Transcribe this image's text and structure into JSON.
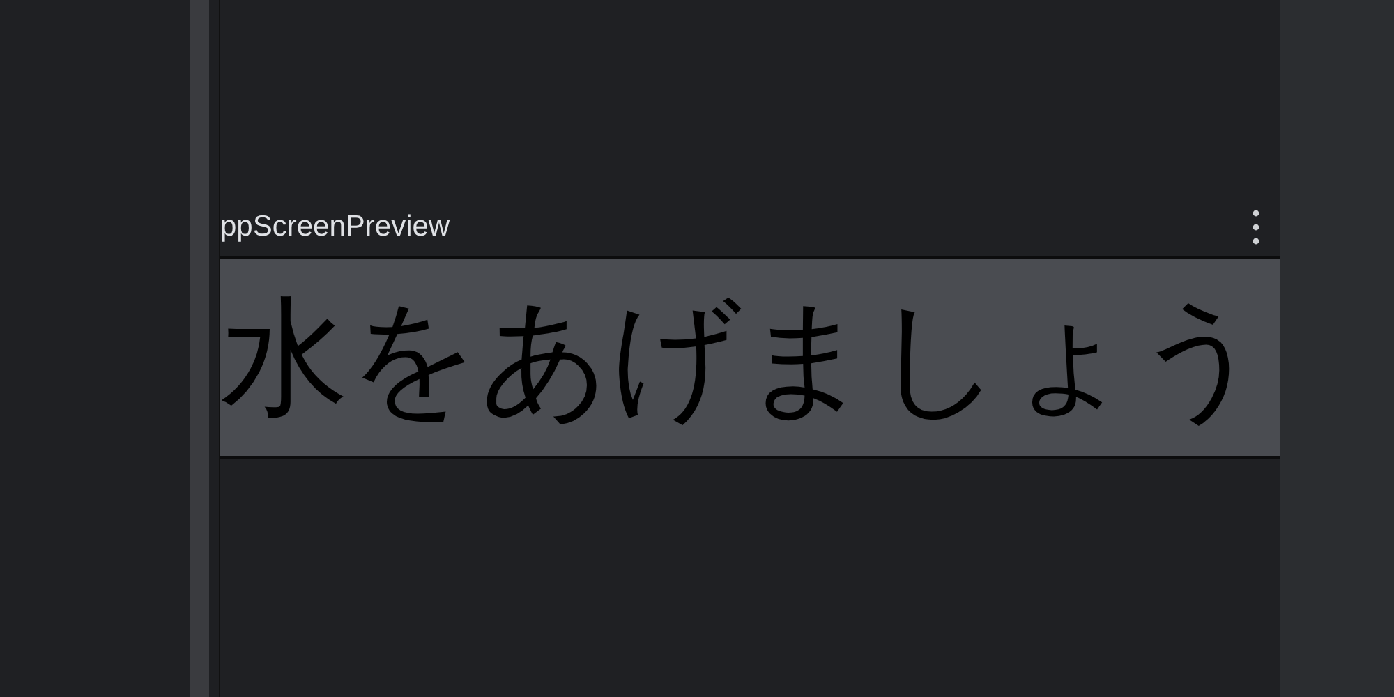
{
  "preview": {
    "title": "ppScreenPreview",
    "content": "水をあげましょう"
  }
}
